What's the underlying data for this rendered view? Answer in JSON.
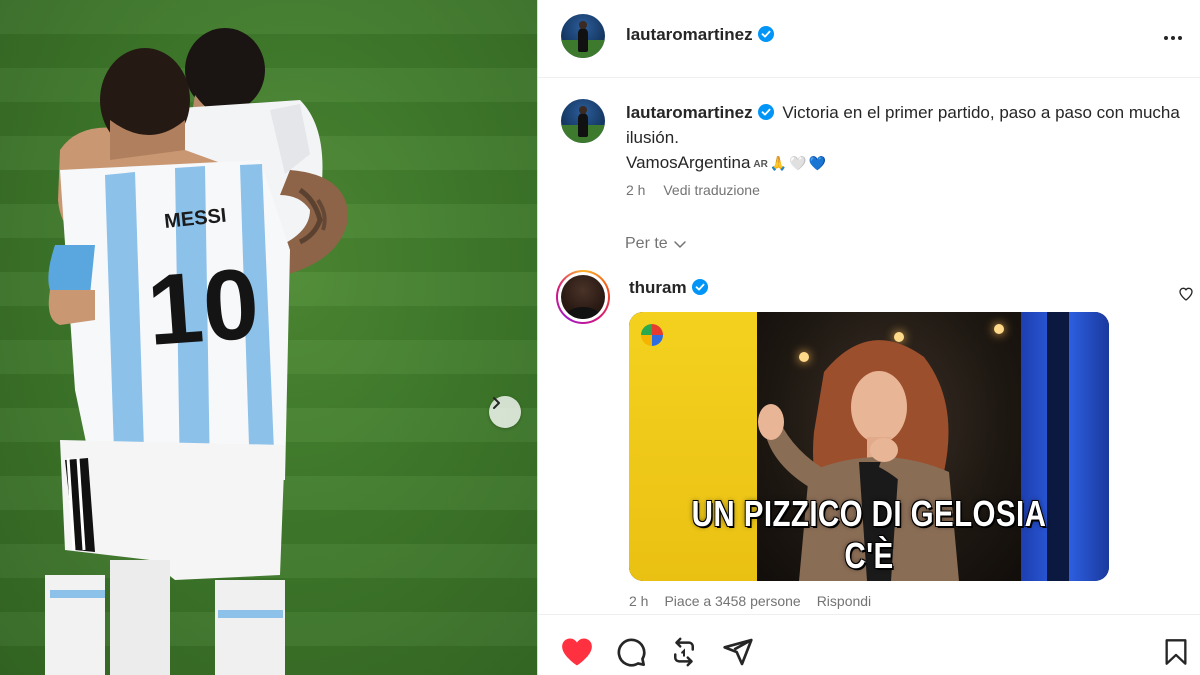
{
  "post": {
    "author": "lautaromartinez",
    "caption_line1": "Victoria en el primer partido, paso a paso con mucha ilusión.",
    "caption_line2": "VamosArgentina",
    "caption_flag": "AR",
    "caption_emojis": [
      "🙏",
      "🤍",
      "💙"
    ],
    "time": "2 h",
    "see_translation": "Vedi traduzione"
  },
  "feed_filter": {
    "label": "Per te"
  },
  "comment": {
    "author": "thuram",
    "gif_text": "UN PIZZICO DI GELOSIA C'È",
    "time": "2 h",
    "likes": "Piace a 3458 persone",
    "reply": "Rispondi"
  },
  "icons": {
    "verified": "verified-badge-icon",
    "more": "more-options-icon",
    "next": "chevron-right-icon",
    "like": "heart-filled-icon",
    "comment": "comment-bubble-icon",
    "repost": "repost-icon",
    "share": "send-icon",
    "save": "bookmark-icon"
  },
  "colors": {
    "like_red": "#ff3040",
    "verified_blue": "#0095f6",
    "text": "#262626",
    "secondary_text": "#737373"
  }
}
